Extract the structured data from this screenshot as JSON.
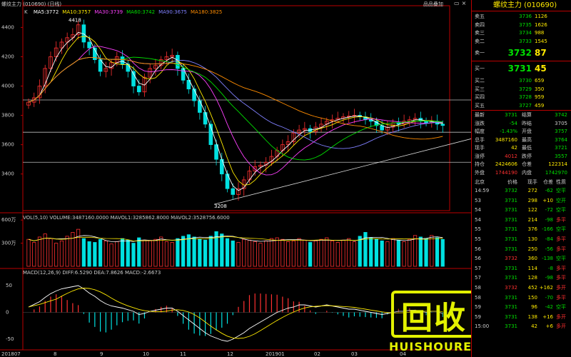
{
  "main": {
    "title": "螺纹主力 (010690) (日线)",
    "menu_right": "品品叠加",
    "ma_label": "K",
    "ma_values": [
      {
        "text": "MA5:3772",
        "color": "#ffffff"
      },
      {
        "text": "MA10:3757",
        "color": "#ffea00"
      },
      {
        "text": "MA30:3739",
        "color": "#ff40ff"
      },
      {
        "text": "MA60:3742",
        "color": "#00e000"
      },
      {
        "text": "MA90:3675",
        "color": "#8080ff"
      },
      {
        "text": "MA180:3825",
        "color": "#ff8c00"
      }
    ],
    "y_ticks": [
      "4400",
      "4200",
      "4000",
      "3800",
      "3600",
      "3400"
    ],
    "high_label": "4418",
    "low_label": "3208"
  },
  "volume": {
    "label": "VOL(5,10) VOLUME:3487160.0000 MAVOL1:3285862.8000 MAVOL2:3528756.6000",
    "y_ticks": [
      "600万",
      "300万"
    ]
  },
  "macd": {
    "label": "MACD(12,26,9) DIFF:6.5290 DEA:7.8626 MACD:-2.6673",
    "y_ticks": [
      "50",
      "0",
      "-50"
    ]
  },
  "x_axis": [
    "201807",
    "8",
    "9",
    "10",
    "11",
    "12",
    "201901",
    "02",
    "03",
    "04"
  ],
  "side_panel": {
    "title": "螺纹主力 (010690)",
    "asks": [
      {
        "label": "卖五",
        "price": "3736",
        "vol": "1126"
      },
      {
        "label": "卖四",
        "price": "3735",
        "vol": "1626"
      },
      {
        "label": "卖三",
        "price": "3734",
        "vol": "988"
      },
      {
        "label": "卖二",
        "price": "3733",
        "vol": "1545"
      }
    ],
    "ask1": {
      "label": "卖一",
      "price": "3732",
      "vol": "87"
    },
    "bid1": {
      "label": "买一",
      "price": "3731",
      "vol": "45"
    },
    "bids": [
      {
        "label": "买二",
        "price": "3730",
        "vol": "659"
      },
      {
        "label": "买三",
        "price": "3729",
        "vol": "350"
      },
      {
        "label": "买四",
        "price": "3728",
        "vol": "959"
      },
      {
        "label": "买五",
        "price": "3727",
        "vol": "459"
      }
    ],
    "stats": [
      {
        "l1": "最新",
        "v1": "3731",
        "c1": "green",
        "l2": "结算",
        "v2": "3742",
        "c2": "green"
      },
      {
        "l1": "涨跌",
        "v1": "-54",
        "c1": "green",
        "l2": "昨结",
        "v2": "3705",
        "c2": "grey"
      },
      {
        "l1": "幅度",
        "v1": "-1.43%",
        "c1": "green",
        "l2": "开盘",
        "v2": "3757",
        "c2": "green"
      },
      {
        "l1": "总手",
        "v1": "3487160",
        "c1": "yellow",
        "l2": "最高",
        "v2": "3764",
        "c2": "green"
      },
      {
        "l1": "现手",
        "v1": "42",
        "c1": "yellow",
        "l2": "最低",
        "v2": "3721",
        "c2": "green"
      },
      {
        "l1": "涨停",
        "v1": "4012",
        "c1": "red",
        "l2": "跌停",
        "v2": "3557",
        "c2": "green"
      },
      {
        "l1": "持仓",
        "v1": "2424606",
        "c1": "yellow",
        "l2": "仓差",
        "v2": "122314",
        "c2": "yellow"
      },
      {
        "l1": "外盘",
        "v1": "1744190",
        "c1": "red",
        "l2": "内盘",
        "v2": "1742970",
        "c2": "green"
      }
    ],
    "tick_header": [
      "北京",
      "价格",
      "现手",
      "仓差",
      "性质"
    ],
    "ticks": [
      {
        "t": "14:59",
        "p": "3732",
        "pc": "green",
        "v": "272",
        "d": "-62",
        "dc": "green",
        "n": "空平"
      },
      {
        "t": "53",
        "p": "3731",
        "pc": "green",
        "v": "298",
        "d": "+10",
        "dc": "yellow",
        "n": "空开"
      },
      {
        "t": "54",
        "p": "3731",
        "pc": "green",
        "v": "122",
        "d": "-72",
        "dc": "green",
        "n": "空平"
      },
      {
        "t": "54",
        "p": "3731",
        "pc": "green",
        "v": "214",
        "d": "-98",
        "dc": "green",
        "n": "多平"
      },
      {
        "t": "55",
        "p": "3731",
        "pc": "green",
        "v": "376",
        "d": "-166",
        "dc": "green",
        "n": "空平"
      },
      {
        "t": "55",
        "p": "3731",
        "pc": "green",
        "v": "130",
        "d": "-84",
        "dc": "green",
        "n": "多平"
      },
      {
        "t": "56",
        "p": "3731",
        "pc": "green",
        "v": "250",
        "d": "-56",
        "dc": "green",
        "n": "多平"
      },
      {
        "t": "56",
        "p": "3732",
        "pc": "red",
        "v": "360",
        "d": "-138",
        "dc": "green",
        "n": "空平"
      },
      {
        "t": "57",
        "p": "3731",
        "pc": "green",
        "v": "114",
        "d": "-8",
        "dc": "green",
        "n": "多平"
      },
      {
        "t": "57",
        "p": "3731",
        "pc": "green",
        "v": "128",
        "d": "-98",
        "dc": "green",
        "n": "多平"
      },
      {
        "t": "58",
        "p": "3732",
        "pc": "red",
        "v": "452",
        "d": "+162",
        "dc": "yellow",
        "n": "多开"
      },
      {
        "t": "58",
        "p": "3731",
        "pc": "green",
        "v": "150",
        "d": "-70",
        "dc": "green",
        "n": "多平"
      },
      {
        "t": "59",
        "p": "3731",
        "pc": "green",
        "v": "96",
        "d": "-42",
        "dc": "green",
        "n": "空平"
      },
      {
        "t": "59",
        "p": "3731",
        "pc": "green",
        "v": "138",
        "d": "+16",
        "dc": "yellow",
        "n": "多开"
      },
      {
        "t": "15:00",
        "p": "3731",
        "pc": "green",
        "v": "42",
        "d": "+6",
        "dc": "yellow",
        "n": "多开"
      }
    ]
  },
  "watermark": {
    "cn": "回收",
    "en": "HUISHOUREN",
    "color": "#e3f200"
  },
  "chart_data": {
    "type": "candlestick",
    "price_range": [
      3208,
      4418
    ],
    "close_series": [
      3890,
      3920,
      4000,
      4120,
      4200,
      4260,
      4300,
      4330,
      4350,
      4418,
      4300,
      4260,
      4180,
      4100,
      4120,
      4160,
      4200,
      4150,
      4100,
      4000,
      3960,
      4060,
      4120,
      4140,
      4180,
      4200,
      4210,
      4120,
      4040,
      3980,
      3900,
      3820,
      3740,
      3600,
      3500,
      3400,
      3300,
      3260,
      3300,
      3360,
      3420,
      3450,
      3460,
      3480,
      3520,
      3560,
      3600,
      3620,
      3680,
      3700,
      3710,
      3690,
      3720,
      3740,
      3760,
      3770,
      3780,
      3790,
      3795,
      3800,
      3790,
      3770,
      3760,
      3730,
      3700,
      3720,
      3750,
      3740,
      3760,
      3770,
      3780,
      3760,
      3750,
      3760,
      3740,
      3731
    ],
    "volume_series": [
      3.5,
      3.1,
      3.8,
      4.2,
      3.6,
      3.0,
      3.3,
      3.9,
      4.4,
      4.8,
      3.6,
      3.2,
      3.1,
      3.5,
      3.3,
      2.9,
      3.2,
      3.6,
      3.4,
      3.0,
      3.7,
      3.4,
      3.3,
      3.5,
      3.8,
      3.2,
      3.1,
      3.6,
      3.9,
      4.1,
      3.8,
      3.5,
      3.4,
      3.9,
      4.5,
      4.2,
      3.6,
      3.3,
      3.1,
      3.5,
      3.4,
      3.2,
      3.0,
      3.3,
      3.6,
      3.7,
      3.5,
      3.2,
      3.3,
      3.6,
      3.4,
      3.1,
      3.3,
      3.5,
      3.7,
      3.3,
      3.1,
      3.4,
      3.6,
      3.2,
      3.9,
      4.4,
      3.7,
      3.5,
      3.3,
      3.2,
      3.6,
      3.4,
      3.2,
      3.5,
      4.0,
      3.8,
      3.6,
      4.0,
      3.7,
      3.49
    ],
    "macd_series": [
      10,
      15,
      20,
      28,
      35,
      40,
      44,
      46,
      48,
      50,
      44,
      36,
      30,
      22,
      16,
      12,
      10,
      8,
      5,
      2,
      -4,
      -2,
      2,
      4,
      6,
      8,
      8,
      2,
      -6,
      -14,
      -22,
      -30,
      -38,
      -44,
      -48,
      -52,
      -54,
      -50,
      -44,
      -38,
      -30,
      -24,
      -18,
      -12,
      -6,
      0,
      4,
      8,
      10,
      14,
      14,
      12,
      10,
      12,
      14,
      12,
      10,
      8,
      6,
      6,
      4,
      2,
      0,
      -2,
      -4,
      -2,
      0,
      2,
      2,
      4,
      4,
      2,
      0,
      2,
      2,
      -2.67
    ]
  }
}
